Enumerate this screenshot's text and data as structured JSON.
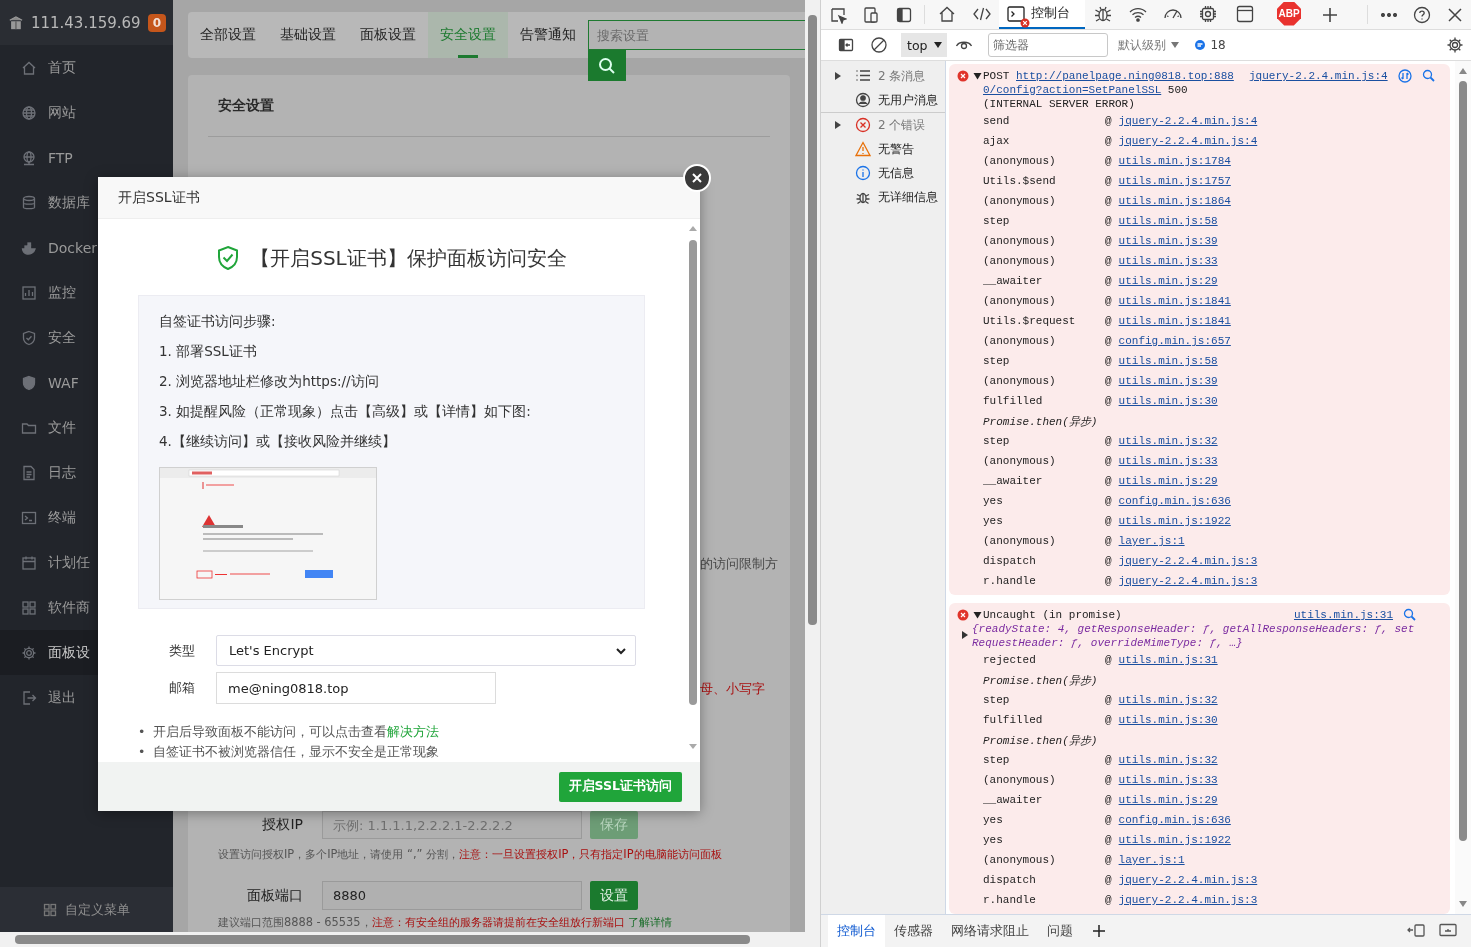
{
  "sidebar": {
    "host": "111.43.159.69",
    "badge": "0",
    "items": [
      {
        "label": "首页",
        "kind": "home",
        "selected": false
      },
      {
        "label": "网站",
        "kind": "globe",
        "selected": false
      },
      {
        "label": "FTP",
        "kind": "ftp",
        "selected": false
      },
      {
        "label": "数据库",
        "kind": "database",
        "selected": false
      },
      {
        "label": "Docker",
        "kind": "docker",
        "selected": false
      },
      {
        "label": "监控",
        "kind": "monitor",
        "selected": false
      },
      {
        "label": "安全",
        "kind": "shield",
        "selected": false
      },
      {
        "label": "WAF",
        "kind": "waf",
        "selected": false
      },
      {
        "label": "文件",
        "kind": "folder",
        "selected": false
      },
      {
        "label": "日志",
        "kind": "log",
        "selected": false
      },
      {
        "label": "终端",
        "kind": "terminal",
        "selected": false
      },
      {
        "label": "计划任",
        "kind": "calendar",
        "selected": false
      },
      {
        "label": "软件商",
        "kind": "apps",
        "selected": false
      },
      {
        "label": "面板设",
        "kind": "gear",
        "selected": true
      },
      {
        "label": "退出",
        "kind": "exit",
        "selected": false
      }
    ],
    "footer": "自定义菜单"
  },
  "settings": {
    "tabs": [
      {
        "label": "全部设置",
        "selected": false
      },
      {
        "label": "基础设置",
        "selected": false
      },
      {
        "label": "面板设置",
        "selected": false
      },
      {
        "label": "安全设置",
        "selected": true
      },
      {
        "label": "告警通知",
        "selected": false
      }
    ],
    "search": {
      "placeholder": "搜索设置"
    },
    "card_title": "安全设置",
    "fragments": [
      {
        "text": "的访问限制方",
        "kind": "note"
      },
      {
        "text": "母、小写字",
        "kind": "warning"
      }
    ],
    "auth_ip": {
      "label": "授权IP",
      "placeholder": "示例: 1.1.1.1,2.2.2.1-2.2.2.2",
      "button": "保存",
      "disabled": true,
      "hint": "设置访问授权IP，多个IP地址，请使用 “,” 分割，",
      "warning": "注意：一旦设置授权IP，只有指定IP的电脑能访问面板"
    },
    "port": {
      "label": "面板端口",
      "value": "8880",
      "button": "设置",
      "disabled": false,
      "hint": "建议端口范围8888 - 65535，",
      "warning": "注意：有安全组的服务器请提前在安全组放行新端口",
      "link": "了解详情"
    }
  },
  "modal": {
    "title": "开启SSL证书",
    "heading": "【开启SSL证书】保护面板访问安全",
    "steps_title": "自签证书访问步骤:",
    "steps": [
      "1. 部署SSL证书",
      "2. 浏览器地址栏修改为https://访问",
      "3. 如提醒风险（正常现象）点击【高级】或【详情】如下图:",
      "4.【继续访问】或【接收风险并继续】"
    ],
    "type_label": "类型",
    "type_value": "Let's Encrypt",
    "email_label": "邮箱",
    "email_value": "me@ning0818.top",
    "notes": [
      {
        "bullet": "•",
        "text": "开启后导致面板不能访问，可以点击查看",
        "link": "解决方法"
      },
      {
        "bullet": "•",
        "text": "自签证书不被浏览器信任，显示不安全是正常现象"
      }
    ],
    "submit": "开启SSL证书访问"
  },
  "devtools": {
    "tabs": [
      {
        "kind": "home",
        "selected": false
      },
      {
        "kind": "elements",
        "selected": false
      },
      {
        "kind": "console",
        "label": "控制台",
        "has_error": true,
        "selected": true
      },
      {
        "kind": "sources",
        "selected": false
      },
      {
        "kind": "network",
        "selected": false
      },
      {
        "kind": "performance",
        "selected": false
      },
      {
        "kind": "memory",
        "selected": false
      },
      {
        "kind": "application",
        "selected": false
      },
      {
        "kind": "abp",
        "label": "ABP",
        "selected": false
      }
    ],
    "context": "top",
    "filter_placeholder": "筛选器",
    "level": "默认级别",
    "message_count": "18",
    "sidebar": [
      {
        "label": "2 条消息",
        "kind": "list",
        "expandable": true,
        "muted": true
      },
      {
        "label": "无用户消息",
        "kind": "user",
        "expandable": false,
        "muted": false
      },
      {
        "label": "2 个错误",
        "kind": "error",
        "expandable": true,
        "muted": true
      },
      {
        "label": "无警告",
        "kind": "warning",
        "expandable": false,
        "muted": false
      },
      {
        "label": "无信息",
        "kind": "info",
        "expandable": false,
        "muted": false
      },
      {
        "label": "无详细信息",
        "kind": "verbose",
        "expandable": false,
        "muted": false
      }
    ],
    "messages": [
      {
        "kind": "network",
        "expanded": true,
        "method": "POST",
        "url": "http://panelpage.ning0818.top:8880/config?action=SetPanelSSL",
        "status": "500",
        "status_text": "(INTERNAL SERVER ERROR)",
        "source": "jquery-2.2.4.min.js:4",
        "frames": [
          {
            "fn": "send",
            "at": "@",
            "src": "jquery-2.2.4.min.js:4"
          },
          {
            "fn": "ajax",
            "at": "@",
            "src": "jquery-2.2.4.min.js:4"
          },
          {
            "fn": "(anonymous)",
            "at": "@",
            "src": "utils.min.js:1784"
          },
          {
            "fn": "Utils.$send",
            "at": "@",
            "src": "utils.min.js:1757"
          },
          {
            "fn": "(anonymous)",
            "at": "@",
            "src": "utils.min.js:1864"
          },
          {
            "fn": "step",
            "at": "@",
            "src": "utils.min.js:58"
          },
          {
            "fn": "(anonymous)",
            "at": "@",
            "src": "utils.min.js:39"
          },
          {
            "fn": "(anonymous)",
            "at": "@",
            "src": "utils.min.js:33"
          },
          {
            "fn": "__awaiter",
            "at": "@",
            "src": "utils.min.js:29"
          },
          {
            "fn": "(anonymous)",
            "at": "@",
            "src": "utils.min.js:1841"
          },
          {
            "fn": "Utils.$request",
            "at": "@",
            "src": "utils.min.js:1841"
          },
          {
            "fn": "(anonymous)",
            "at": "@",
            "src": "config.min.js:657"
          },
          {
            "fn": "step",
            "at": "@",
            "src": "utils.min.js:58"
          },
          {
            "fn": "(anonymous)",
            "at": "@",
            "src": "utils.min.js:39"
          },
          {
            "fn": "fulfilled",
            "at": "@",
            "src": "utils.min.js:30"
          },
          {
            "kind": "async",
            "text": "Promise.then(异步)"
          },
          {
            "fn": "step",
            "at": "@",
            "src": "utils.min.js:32"
          },
          {
            "fn": "(anonymous)",
            "at": "@",
            "src": "utils.min.js:33"
          },
          {
            "fn": "__awaiter",
            "at": "@",
            "src": "utils.min.js:29"
          },
          {
            "fn": "yes",
            "at": "@",
            "src": "config.min.js:636"
          },
          {
            "fn": "yes",
            "at": "@",
            "src": "utils.min.js:1922"
          },
          {
            "fn": "(anonymous)",
            "at": "@",
            "src": "layer.js:1"
          },
          {
            "fn": "dispatch",
            "at": "@",
            "src": "jquery-2.2.4.min.js:3"
          },
          {
            "fn": "r.handle",
            "at": "@",
            "src": "jquery-2.2.4.min.js:3"
          }
        ]
      },
      {
        "kind": "exception",
        "expanded": true,
        "text": "Uncaught (in promise)",
        "source": "utils.min.js:31",
        "object": "{readyState: 4, getResponseHeader: ƒ, getAllResponseHeaders: ƒ, setRequestHeader: ƒ, overrideMimeType: ƒ, …}",
        "frames": [
          {
            "fn": "rejected",
            "at": "@",
            "src": "utils.min.js:31"
          },
          {
            "kind": "async",
            "text": "Promise.then(异步)"
          },
          {
            "fn": "step",
            "at": "@",
            "src": "utils.min.js:32"
          },
          {
            "fn": "fulfilled",
            "at": "@",
            "src": "utils.min.js:30"
          },
          {
            "kind": "async",
            "text": "Promise.then(异步)"
          },
          {
            "fn": "step",
            "at": "@",
            "src": "utils.min.js:32"
          },
          {
            "fn": "(anonymous)",
            "at": "@",
            "src": "utils.min.js:33"
          },
          {
            "fn": "__awaiter",
            "at": "@",
            "src": "utils.min.js:29"
          },
          {
            "fn": "yes",
            "at": "@",
            "src": "config.min.js:636"
          },
          {
            "fn": "yes",
            "at": "@",
            "src": "utils.min.js:1922"
          },
          {
            "fn": "(anonymous)",
            "at": "@",
            "src": "layer.js:1"
          },
          {
            "fn": "dispatch",
            "at": "@",
            "src": "jquery-2.2.4.min.js:3"
          },
          {
            "fn": "r.handle",
            "at": "@",
            "src": "jquery-2.2.4.min.js:3"
          }
        ]
      }
    ],
    "drawer_tabs": [
      {
        "label": "控制台",
        "selected": true
      },
      {
        "label": "传感器",
        "selected": false
      },
      {
        "label": "网络请求阻止",
        "selected": false
      },
      {
        "label": "问题",
        "selected": false
      }
    ]
  }
}
